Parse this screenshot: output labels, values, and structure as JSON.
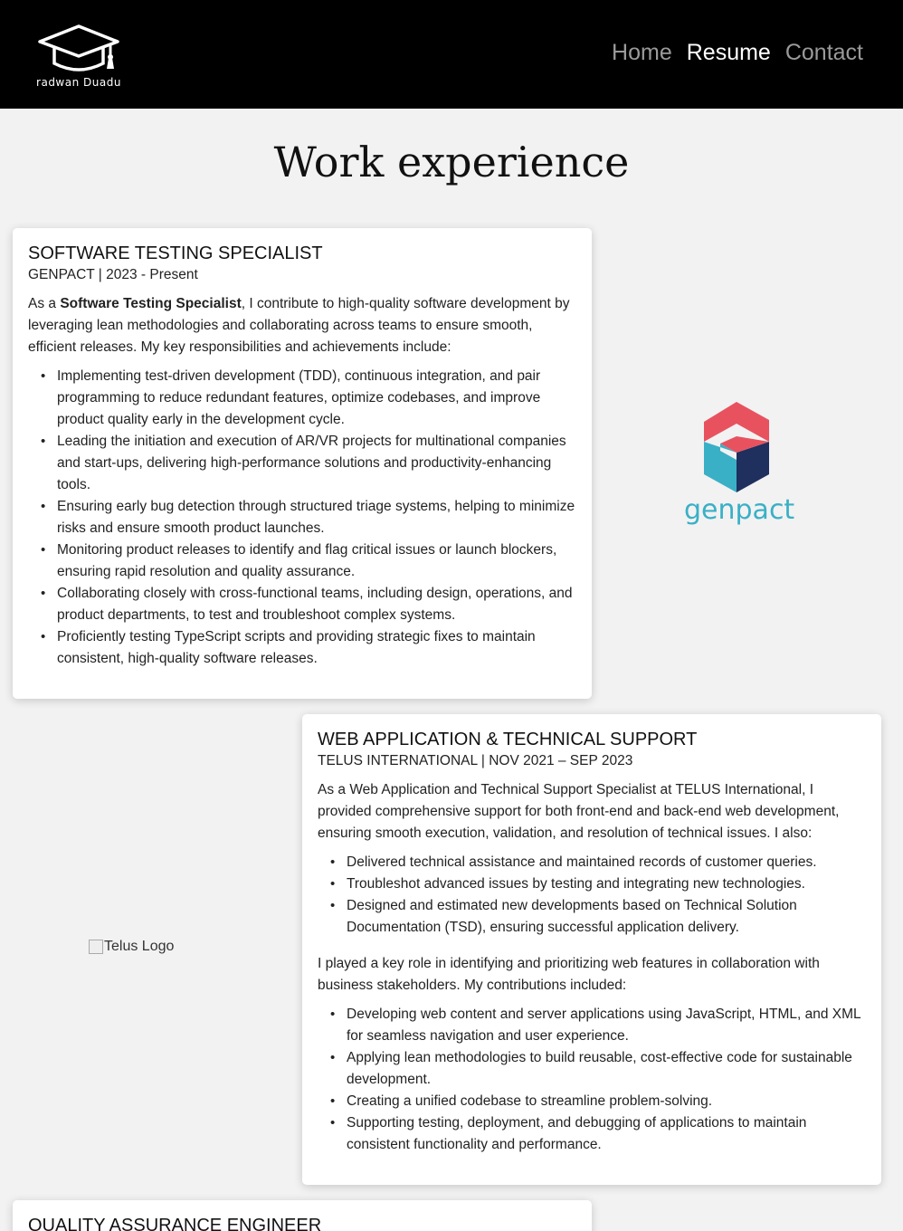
{
  "header": {
    "logo_text": "radwan Duadu",
    "nav": [
      {
        "label": "Home",
        "active": false
      },
      {
        "label": "Resume",
        "active": true
      },
      {
        "label": "Contact",
        "active": false
      }
    ]
  },
  "page_title": "Work experience",
  "jobs": [
    {
      "title": "SOFTWARE TESTING SPECIALIST",
      "meta": "GENPACT | 2023 - Present",
      "intro_prefix": "As a ",
      "intro_bold": "Software Testing Specialist",
      "intro_suffix": ", I contribute to high-quality software development by leveraging lean methodologies and collaborating across teams to ensure smooth, efficient releases. My key responsibilities and achievements include:",
      "items": [
        "Implementing test-driven development (TDD), continuous integration, and pair programming to reduce redundant features, optimize codebases, and improve product quality early in the development cycle.",
        "Leading the initiation and execution of AR/VR projects for multinational companies and start-ups, delivering high-performance solutions and productivity-enhancing tools.",
        "Ensuring early bug detection through structured triage systems, helping to minimize risks and ensure smooth product launches.",
        "Monitoring product releases to identify and flag critical issues or launch blockers, ensuring rapid resolution and quality assurance.",
        "Collaborating closely with cross-functional teams, including design, operations, and product departments, to test and troubleshoot complex systems.",
        "Proficiently testing TypeScript scripts and providing strategic fixes to maintain consistent, high-quality software releases."
      ],
      "logo_word": "genpact",
      "logo_colors": {
        "top": "#e8525f",
        "left": "#3ab0c6",
        "right": "#1f2f5e"
      }
    },
    {
      "title": "WEB APPLICATION & TECHNICAL SUPPORT",
      "meta": "TELUS INTERNATIONAL | NOV 2021 – SEP 2023",
      "intro": "As a Web Application and Technical Support Specialist at TELUS International, I provided comprehensive support for both front-end and back-end web development, ensuring smooth execution, validation, and resolution of technical issues. I also:",
      "items": [
        "Delivered technical assistance and maintained records of customer queries.",
        "Troubleshot advanced issues by testing and integrating new technologies.",
        "Designed and estimated new developments based on Technical Solution Documentation (TSD), ensuring successful application delivery."
      ],
      "intro2": "I played a key role in identifying and prioritizing web features in collaboration with business stakeholders. My contributions included:",
      "items2": [
        "Developing web content and server applications using JavaScript, HTML, and XML for seamless navigation and user experience.",
        "Applying lean methodologies to build reusable, cost-effective code for sustainable development.",
        "Creating a unified codebase to streamline problem-solving.",
        "Supporting testing, deployment, and debugging of applications to maintain consistent functionality and performance."
      ],
      "logo_alt": "Telus Logo"
    },
    {
      "title": "QUALITY ASSURANCE ENGINEER"
    }
  ]
}
